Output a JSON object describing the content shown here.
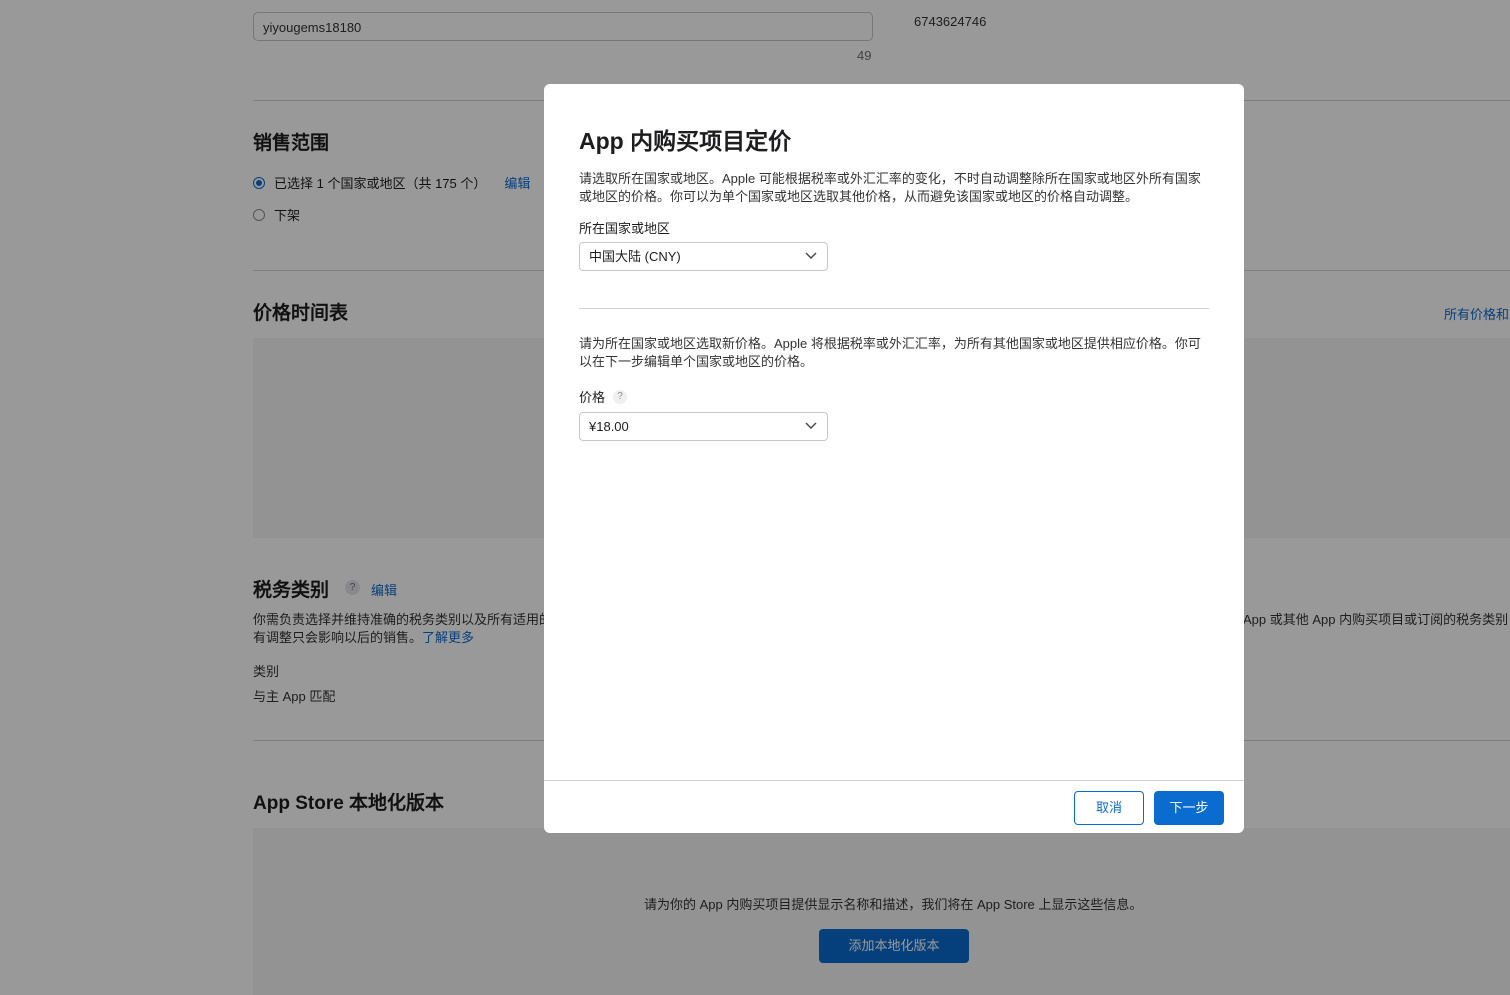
{
  "background": {
    "reference_name_value": "yiyougems18180",
    "reference_name_count": "49",
    "apple_id_value": "6743624746",
    "availability": {
      "title": "销售范围",
      "selected_option": "已选择 1 个国家或地区（共 175 个）",
      "edit_link": "编辑",
      "remove_option": "下架"
    },
    "price_schedule": {
      "title": "价格时间表",
      "all_prices_link": "所有价格和"
    },
    "tax": {
      "title": "税务类别",
      "help": "?",
      "edit_link": "编辑",
      "description_left": "你需负责选择并维持准确的税务类别以及所有适用的",
      "description_right": "App 或其他 App 内购买项目或订阅的税务类别",
      "description_line2": "有调整只会影响以后的销售。",
      "learn_more": "了解更多",
      "category_label": "类别",
      "category_value": "与主 App 匹配"
    },
    "localization": {
      "title": "App Store 本地化版本",
      "message": "请为你的 App 内购买项目提供显示名称和描述，我们将在 App Store 上显示这些信息。",
      "add_button": "添加本地化版本"
    }
  },
  "modal": {
    "title": "App 内购买项目定价",
    "description1": "请选取所在国家或地区。Apple 可能根据税率或外汇汇率的变化，不时自动调整除所在国家或地区外所有国家或地区的价格。你可以为单个国家或地区选取其他价格，从而避免该国家或地区的价格自动调整。",
    "country_label": "所在国家或地区",
    "country_value": "中国大陆 (CNY)",
    "description2": "请为所在国家或地区选取新价格。Apple 将根据税率或外汇汇率，为所有其他国家或地区提供相应价格。你可以在下一步编辑单个国家或地区的价格。",
    "price_label": "价格",
    "price_help": "?",
    "price_value": "¥18.00",
    "cancel_button": "取消",
    "next_button": "下一步"
  },
  "colors": {
    "accent": "#0a6ccf",
    "overlay": "rgba(0,0,0,0.40)"
  },
  "icons": [
    "chevron-down-icon",
    "help-icon",
    "radio-selected-icon",
    "radio-unselected-icon"
  ]
}
